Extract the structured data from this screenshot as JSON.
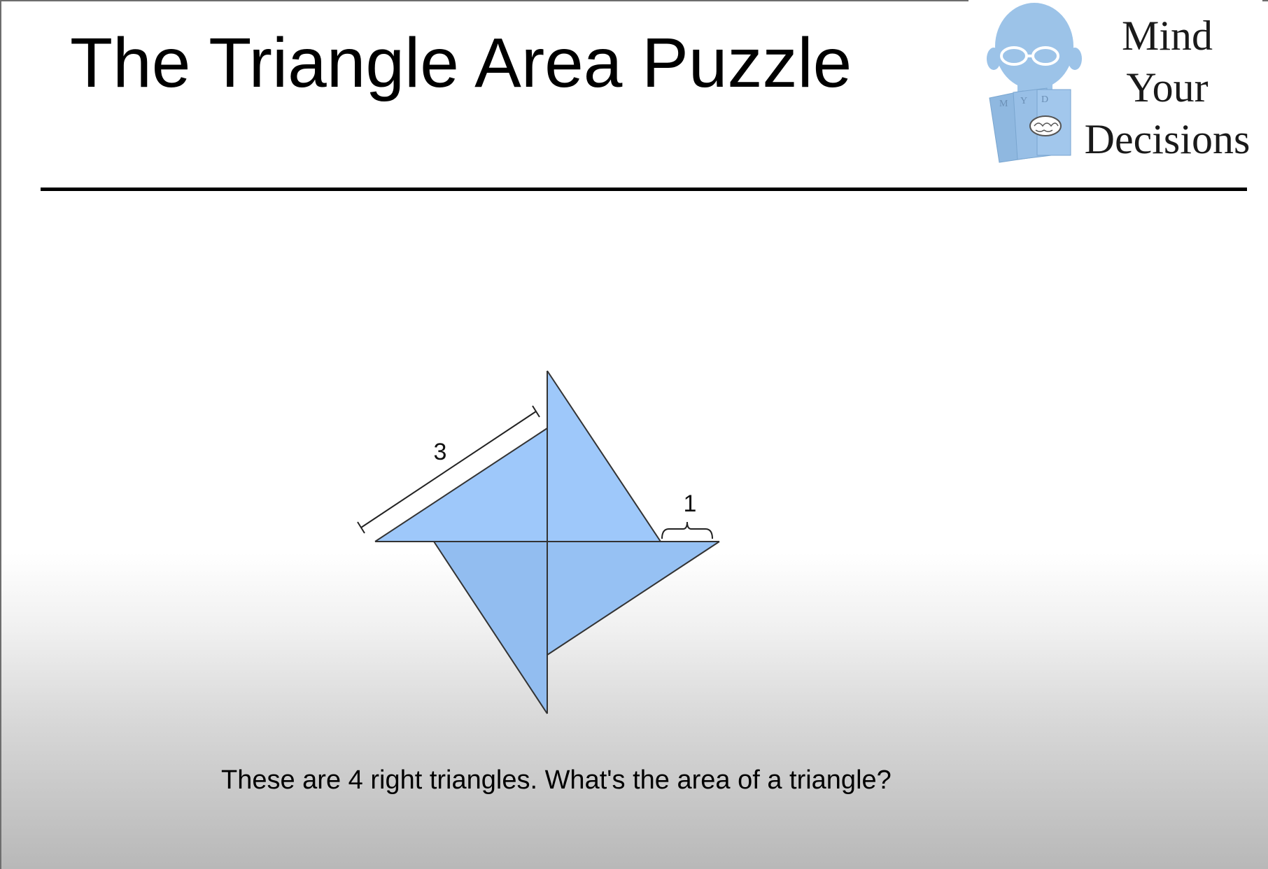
{
  "slide": {
    "title": "The Triangle Area Puzzle",
    "caption": "These are 4 right triangles. What's the area of a triangle?"
  },
  "logo": {
    "line1": "Mind",
    "line2": "Your",
    "line3": "Decisions",
    "card_letters": "M Y D"
  },
  "diagram": {
    "hypotenuse_label": "3",
    "gap_label": "1",
    "triangle_color": "#9ec8fa",
    "edge_color": "#333333"
  }
}
